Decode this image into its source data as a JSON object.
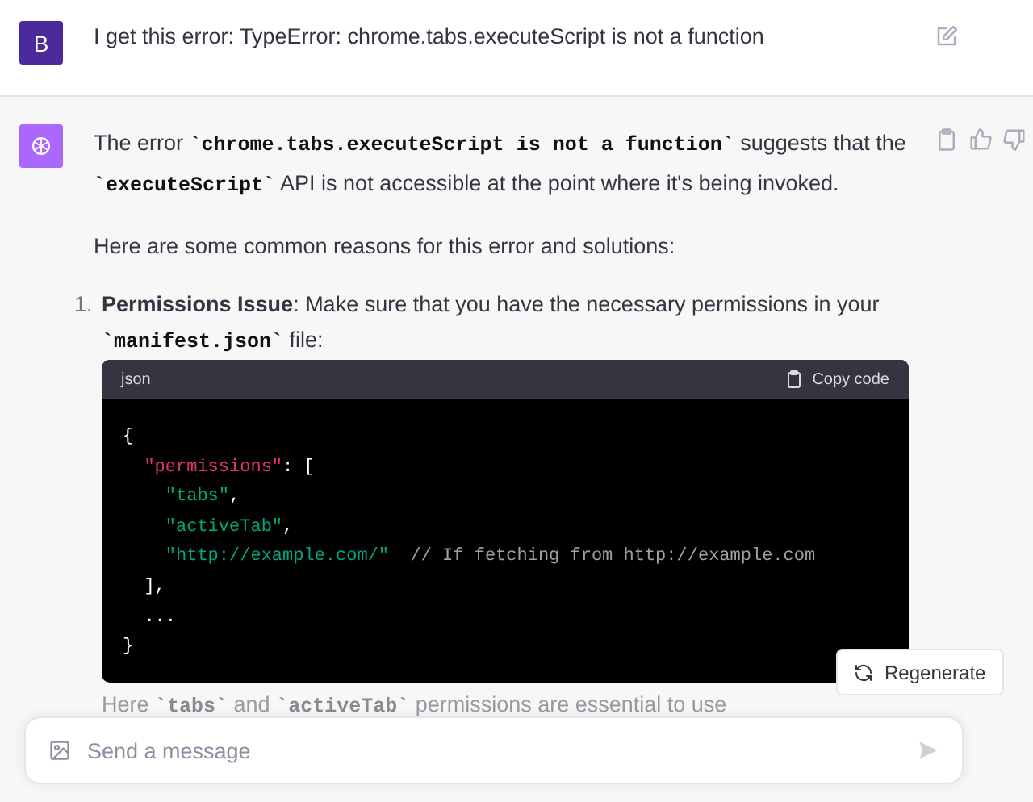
{
  "user_message": {
    "avatar_letter": "B",
    "parts": [
      {
        "kind": "text",
        "text": "I get this error: TypeError: chrome.tabs.executeScript is not a function"
      }
    ]
  },
  "assistant_message": {
    "blocks": [
      {
        "kind": "paragraph",
        "parts": [
          {
            "kind": "text",
            "text": "The error "
          },
          {
            "kind": "code",
            "text": "`chrome.tabs.executeScript is not a function`"
          },
          {
            "kind": "text",
            "text": " suggests that the "
          },
          {
            "kind": "code",
            "text": "`executeScript`"
          },
          {
            "kind": "text",
            "text": " API is not accessible at the point where it's being invoked."
          }
        ]
      },
      {
        "kind": "paragraph",
        "parts": [
          {
            "kind": "text",
            "text": "Here are some common reasons for this error and solutions:"
          }
        ]
      },
      {
        "kind": "list_item",
        "number": "1.",
        "parts": [
          {
            "kind": "bold",
            "text": "Permissions Issue"
          },
          {
            "kind": "text",
            "text": ": Make sure that you have the necessary permissions in your "
          },
          {
            "kind": "code",
            "text": "`manifest.json`"
          },
          {
            "kind": "text",
            "text": " file:"
          }
        ]
      },
      {
        "kind": "code_block",
        "language": "json",
        "copy_label": "Copy code",
        "lines": [
          [
            {
              "kind": "punct",
              "text": "{"
            }
          ],
          [
            {
              "kind": "key",
              "text": "  \"permissions\""
            },
            {
              "kind": "punct",
              "text": ": ["
            }
          ],
          [
            {
              "kind": "string",
              "text": "    \"tabs\""
            },
            {
              "kind": "punct",
              "text": ","
            }
          ],
          [
            {
              "kind": "string",
              "text": "    \"activeTab\""
            },
            {
              "kind": "punct",
              "text": ","
            }
          ],
          [
            {
              "kind": "string",
              "text": "    \"http://example.com/\""
            },
            {
              "kind": "comment",
              "text": "  // If fetching from http://example.com"
            }
          ],
          [
            {
              "kind": "punct",
              "text": "  ],"
            }
          ],
          [
            {
              "kind": "punct",
              "text": "  ..."
            }
          ],
          [
            {
              "kind": "punct",
              "text": "}"
            }
          ]
        ]
      },
      {
        "kind": "faded",
        "parts": [
          {
            "kind": "text",
            "text": "Here "
          },
          {
            "kind": "code",
            "text": "`tabs`"
          },
          {
            "kind": "text",
            "text": " and "
          },
          {
            "kind": "code",
            "text": "`activeTab`"
          },
          {
            "kind": "text",
            "text": " permissions are essential to use"
          }
        ]
      }
    ]
  },
  "regenerate_button": {
    "label": "Regenerate"
  },
  "composer": {
    "placeholder": "Send a message"
  }
}
